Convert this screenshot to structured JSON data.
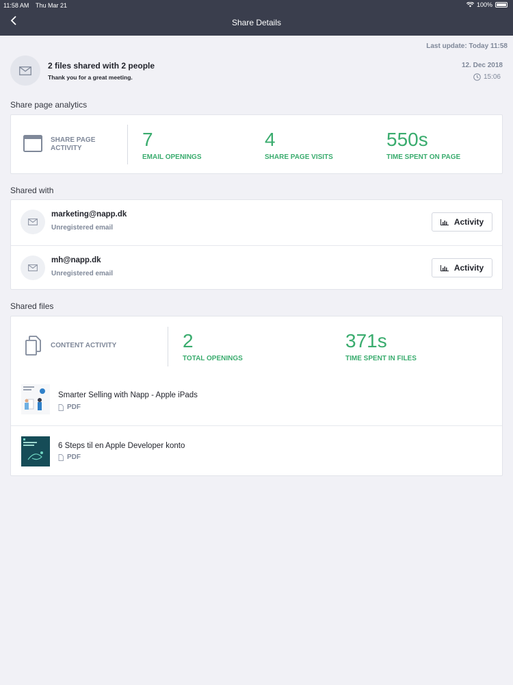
{
  "status_bar": {
    "time": "11:58 AM",
    "date": "Thu Mar 21",
    "battery": "100%"
  },
  "nav": {
    "title": "Share Details"
  },
  "last_update": "Last update: Today 11:58",
  "header": {
    "title": "2 files shared with 2 people",
    "subtitle": "Thank you for a great meeting.",
    "date": "12. Dec 2018",
    "time": "15:06"
  },
  "analytics": {
    "section_label": "Share page analytics",
    "left_label_line1": "SHARE PAGE",
    "left_label_line2": "ACTIVITY",
    "metrics": [
      {
        "value": "7",
        "label": "EMAIL OPENINGS"
      },
      {
        "value": "4",
        "label": "SHARE PAGE VISITS"
      },
      {
        "value": "550s",
        "label": "TIME SPENT ON PAGE"
      }
    ]
  },
  "shared_with": {
    "section_label": "Shared with",
    "people": [
      {
        "email": "marketing@napp.dk",
        "status": "Unregistered email",
        "button": "Activity"
      },
      {
        "email": "mh@napp.dk",
        "status": "Unregistered email",
        "button": "Activity"
      }
    ]
  },
  "shared_files": {
    "section_label": "Shared files",
    "left_label": "CONTENT ACTIVITY",
    "metrics": [
      {
        "value": "2",
        "label": "TOTAL OPENINGS"
      },
      {
        "value": "371s",
        "label": "TIME SPENT IN FILES"
      }
    ],
    "files": [
      {
        "title": "Smarter Selling with Napp - Apple iPads",
        "type": "PDF"
      },
      {
        "title": "6 Steps til en Apple Developer konto",
        "type": "PDF"
      }
    ]
  },
  "colors": {
    "accent_green": "#3aac6e",
    "topbar": "#3a3e4d",
    "muted": "#7f8899"
  }
}
